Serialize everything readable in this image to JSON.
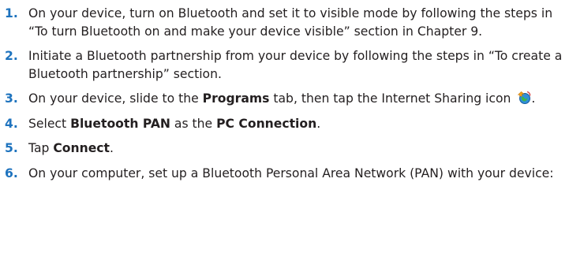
{
  "steps": [
    {
      "number": "1.",
      "text": "On your device, turn on Bluetooth and set it to visible mode by following the steps in “To turn Bluetooth on and make your device visible” section in Chapter 9."
    },
    {
      "number": "2.",
      "text": "Initiate a Bluetooth partnership from your device by following the steps in “To create a Bluetooth partnership” section."
    },
    {
      "number": "3.",
      "parts": [
        "On your device, slide to the ",
        "Programs",
        " tab, then tap the Internet Sharing icon ",
        "."
      ],
      "icon": "internet-sharing-icon"
    },
    {
      "number": "4.",
      "parts": [
        "Select ",
        "Bluetooth PAN",
        " as the ",
        "PC Connection",
        "."
      ]
    },
    {
      "number": "5.",
      "parts": [
        "Tap ",
        "Connect",
        "."
      ]
    },
    {
      "number": "6.",
      "text": "On your computer, set up a Bluetooth Personal Area Network (PAN) with your device:"
    }
  ],
  "colors": {
    "step_number": "#1e73be",
    "body_text": "#231f20"
  }
}
